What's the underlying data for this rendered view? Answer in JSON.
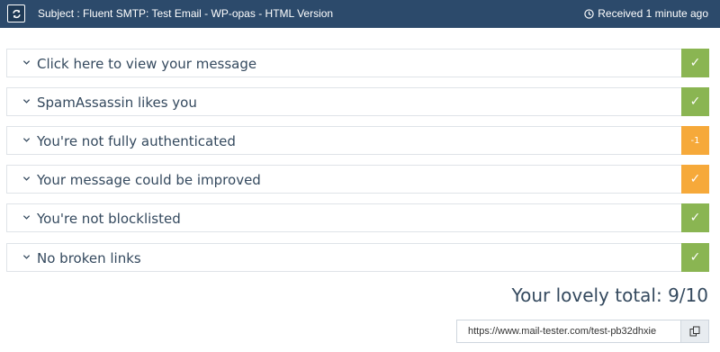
{
  "header": {
    "refresh_icon": "refresh-icon",
    "subject": "Subject : Fluent SMTP: Test Email - WP-opas - HTML Version",
    "received": "Received 1 minute ago",
    "clock_icon": "clock-icon"
  },
  "results": [
    {
      "label": "Click here to view your message",
      "status": "ok",
      "badge": "✓"
    },
    {
      "label": "SpamAssassin likes you",
      "status": "ok",
      "badge": "✓"
    },
    {
      "label": "You're not fully authenticated",
      "status": "warn",
      "badge": "-1"
    },
    {
      "label": "Your message could be improved",
      "status": "warn",
      "badge": "✓"
    },
    {
      "label": "You're not blocklisted",
      "status": "ok",
      "badge": "✓"
    },
    {
      "label": "No broken links",
      "status": "ok",
      "badge": "✓"
    }
  ],
  "total": "Your lovely total: 9/10",
  "share": {
    "url": "https://www.mail-tester.com/test-pb32dhxie",
    "copy_icon": "copy-icon"
  },
  "colors": {
    "header_bg": "#2c4a6b",
    "ok": "#8ab552",
    "warn": "#f6a93a",
    "text": "#34495e"
  }
}
